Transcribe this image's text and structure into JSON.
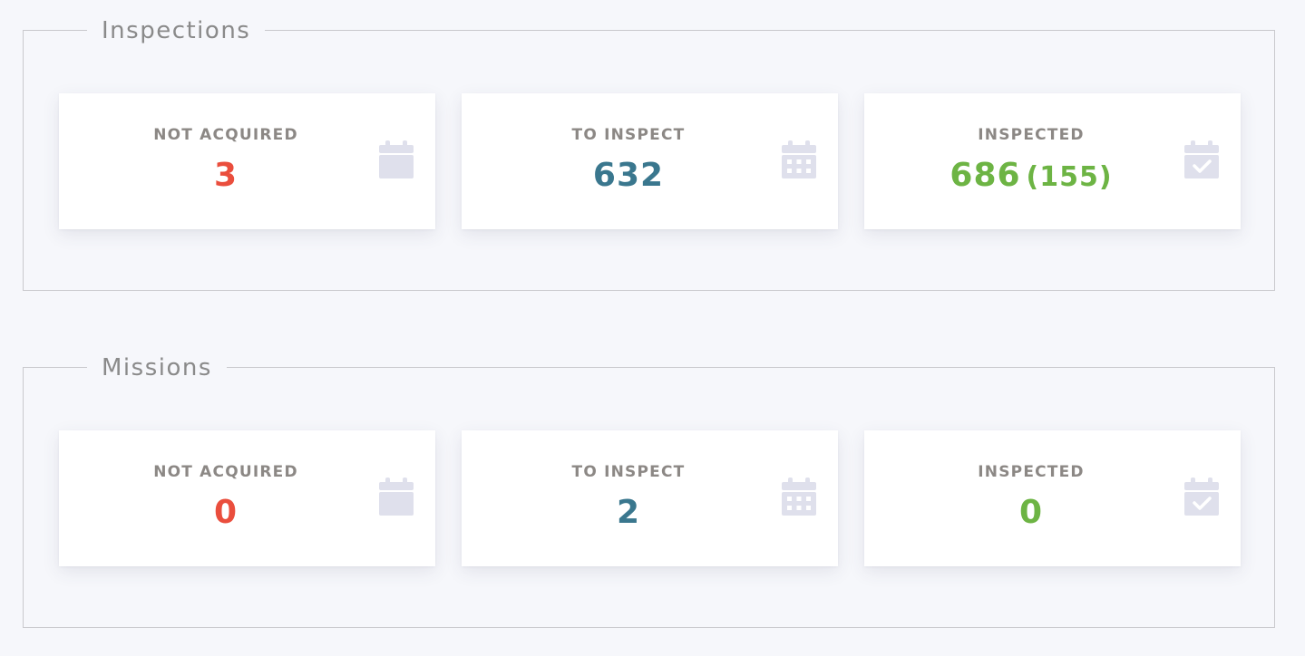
{
  "colors": {
    "background": "#f6f7fb",
    "border": "#c9c9cd",
    "label": "#8c8885",
    "not_acquired": "#ea4e3d",
    "to_inspect": "#3a778e",
    "inspected": "#6db444",
    "icon": "#dfe0ec"
  },
  "inspections": {
    "title": "Inspections",
    "not_acquired": {
      "label": "NOT ACQUIRED",
      "value": "3",
      "icon": "calendar-blank-icon"
    },
    "to_inspect": {
      "label": "TO INSPECT",
      "value": "632",
      "icon": "calendar-grid-icon"
    },
    "inspected": {
      "label": "INSPECTED",
      "value": "686",
      "sub": "(155)",
      "icon": "calendar-check-icon"
    }
  },
  "missions": {
    "title": "Missions",
    "not_acquired": {
      "label": "NOT ACQUIRED",
      "value": "0",
      "icon": "calendar-blank-icon"
    },
    "to_inspect": {
      "label": "TO INSPECT",
      "value": "2",
      "icon": "calendar-grid-icon"
    },
    "inspected": {
      "label": "INSPECTED",
      "value": "0",
      "icon": "calendar-check-icon"
    }
  }
}
